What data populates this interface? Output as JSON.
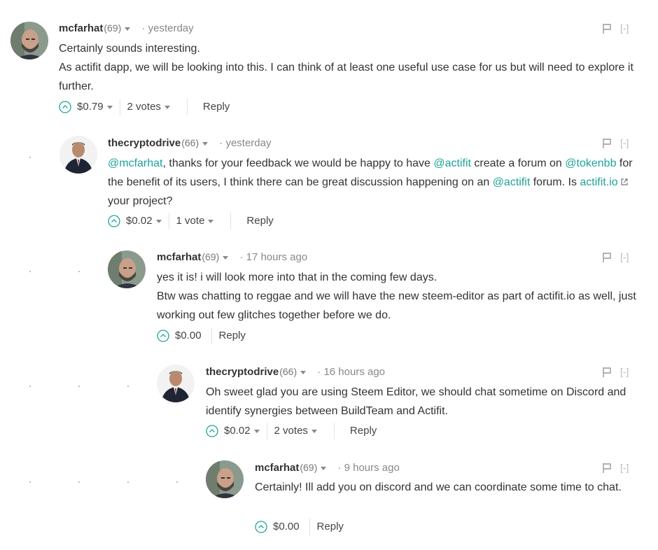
{
  "comments": [
    {
      "author": "mcfarhat",
      "reputation": "(69)",
      "time": "· yesterday",
      "collapse": "[-]",
      "paragraphs": [
        "Certainly sounds interesting.",
        "As actifit dapp, we will be looking into this. I can think of at least one useful use case for us but will need to explore it further."
      ],
      "payout": "$0.79",
      "votes": "2 votes",
      "reply": "Reply"
    },
    {
      "author": "thecryptodrive",
      "reputation": "(66)",
      "time": "· yesterday",
      "collapse": "[-]",
      "body": {
        "mention1": "@mcfarhat",
        "t1": ", thanks for your feedback we would be happy to have ",
        "mention2": "@actifit",
        "t2": " create a forum on ",
        "mention3": "@tokenbb",
        "t3": " for the benefit of its users, I think there can be great discussion happening on an ",
        "mention4": "@actifit",
        "t4": " forum. Is ",
        "link": "actifit.io",
        "t5": " your project?"
      },
      "payout": "$0.02",
      "votes": "1 vote",
      "reply": "Reply"
    },
    {
      "author": "mcfarhat",
      "reputation": "(69)",
      "time": "· 17 hours ago",
      "collapse": "[-]",
      "paragraphs": [
        "yes it is! i will look more into that in the coming few days.",
        "Btw was chatting to reggae and we will have the new steem-editor as part of actifit.io as well, just working out few glitches together before we do."
      ],
      "payout": "$0.00",
      "reply": "Reply"
    },
    {
      "author": "thecryptodrive",
      "reputation": "(66)",
      "time": "· 16 hours ago",
      "collapse": "[-]",
      "paragraphs": [
        "Oh sweet glad you are using Steem Editor, we should chat sometime on Discord and identify synergies between BuildTeam and Actifit."
      ],
      "payout": "$0.02",
      "votes": "2 votes",
      "reply": "Reply"
    },
    {
      "author": "mcfarhat",
      "reputation": "(69)",
      "time": "· 9 hours ago",
      "collapse": "[-]",
      "paragraphs": [
        "Certainly! Ill add you on discord and we can coordinate some time to chat."
      ],
      "payout": "$0.00",
      "reply": "Reply"
    }
  ],
  "icons": {
    "upvote": "upvote-circle-icon",
    "flag": "flag-icon",
    "dropdown": "chevron-down-icon",
    "external": "external-link-icon"
  },
  "colors": {
    "accent": "#1ea39a",
    "text": "#333333",
    "muted": "#888888"
  }
}
